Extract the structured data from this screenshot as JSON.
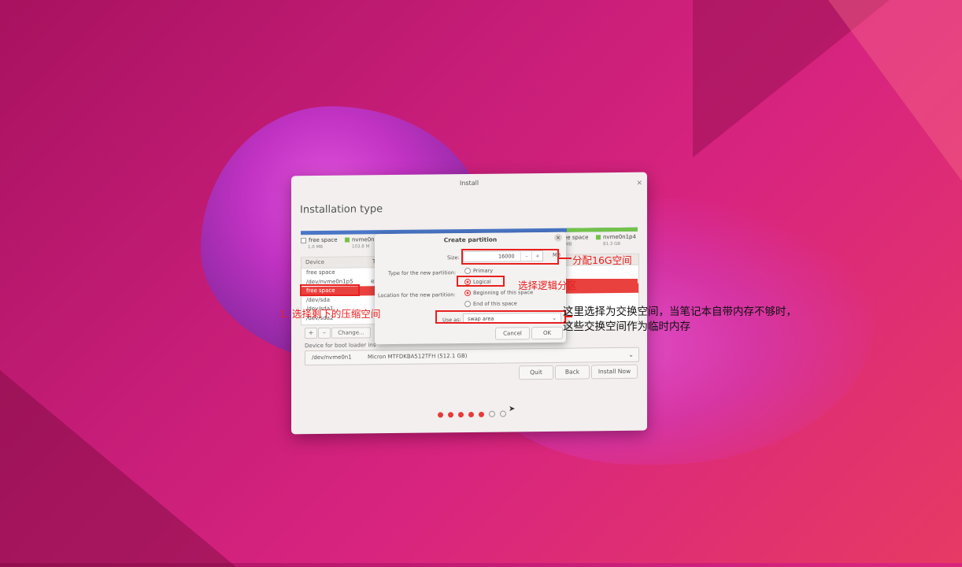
{
  "window": {
    "title": "Install",
    "close_glyph": "×",
    "page_title": "Installation type",
    "legend": [
      {
        "label": "free space",
        "size": "1.0 MB",
        "color": "#ffffff"
      },
      {
        "label": "nvme0n",
        "size": "103.8 M",
        "color": "#73c24a"
      },
      {
        "label": "ee space",
        "size": "MB",
        "color": "#ffffff"
      },
      {
        "label": "nvme0n1p4",
        "size": "81.3 GB",
        "color": "#73c24a"
      }
    ],
    "table": {
      "header_device": "Device",
      "header_type": "T",
      "rows": [
        {
          "device": "free space",
          "extra": ""
        },
        {
          "device": "/dev/nvme0n1p5",
          "extra": "ex"
        },
        {
          "device": "free space",
          "extra": "",
          "selected": true
        },
        {
          "device": "/dev/sda",
          "extra": ""
        },
        {
          "device": "/dev/sda1",
          "extra": ""
        },
        {
          "device": "/dev/sda2",
          "extra": ""
        }
      ]
    },
    "table_buttons": {
      "add": "+",
      "remove": "–",
      "change": "Change..."
    },
    "boot_loader": {
      "label": "Device for boot loader ins",
      "device": "/dev/nvme0n1",
      "description": "Micron MTFDKBA512TFH (512.1 GB)",
      "arrow": "⌄"
    },
    "actions": {
      "quit": "Quit",
      "back": "Back",
      "install": "Install Now"
    },
    "progress": {
      "total_steps": 7,
      "completed_steps": 5
    }
  },
  "dialog": {
    "title": "Create partition",
    "close_glyph": "×",
    "size_label": "Size:",
    "size_value": "16000",
    "minus": "–",
    "plus": "+",
    "unit": "MB",
    "type_label": "Type for the new partition:",
    "type_options": [
      "Primary",
      "Logical"
    ],
    "type_selected": "Logical",
    "location_label": "Location for the new partition:",
    "location_options": [
      "Beginning of this space",
      "End of this space"
    ],
    "location_selected": "Beginning of this space",
    "use_as_label": "Use as:",
    "use_as_value": "swap area",
    "use_as_arrow": "⌄",
    "cancel": "Cancel",
    "ok": "OK"
  },
  "annotations": {
    "step1": "1. 选择剩下的压缩空间",
    "size_note": "分配16G空间",
    "logical_note": "选择逻辑分区",
    "swap_note_line1": "这里选择为交换空间，当笔记本自带内存不够时，",
    "swap_note_line2": "这些交换空间作为临时内存",
    "color": "#e82020"
  }
}
